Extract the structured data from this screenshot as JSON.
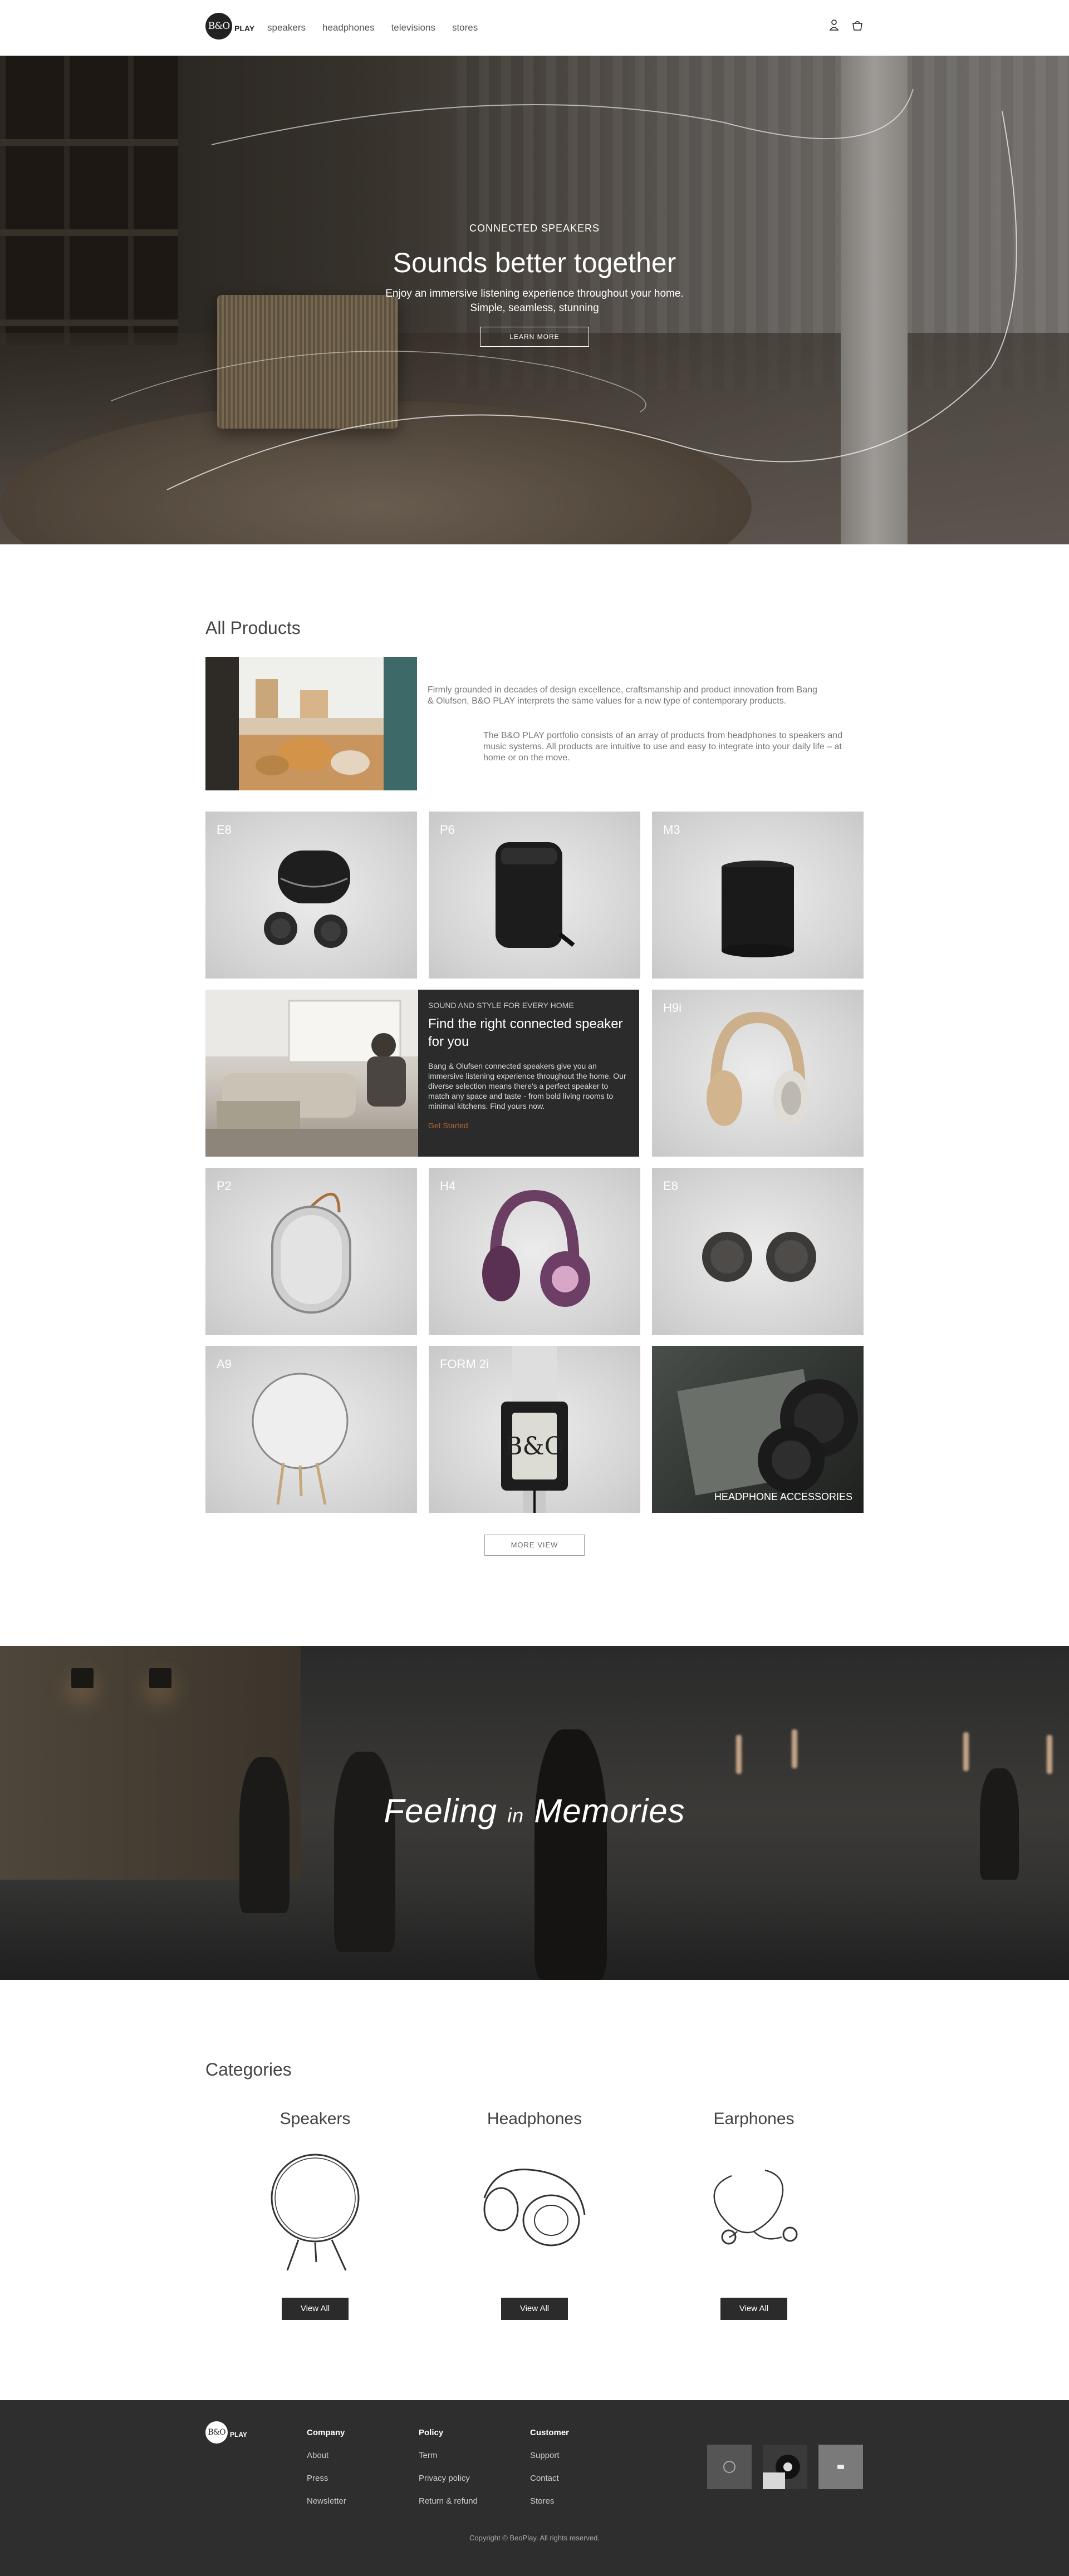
{
  "header": {
    "logo_mark": "B&O",
    "logo_text": "PLAY",
    "nav": [
      "speakers",
      "headphones",
      "televisions",
      "stores"
    ],
    "icons": [
      "user-icon",
      "bag-icon"
    ]
  },
  "hero": {
    "eyebrow": "CONNECTED SPEAKERS",
    "title": "Sounds better together",
    "desc_line1": "Enjoy an immersive listening experience throughout your home.",
    "desc_line2": "Simple, seamless, stunning",
    "button": "LEARN MORE"
  },
  "products": {
    "title": "All Products",
    "intro1": "Firmly grounded in decades of design excellence, craftsmanship and product innovation from Bang & Olufsen, B&O PLAY interprets the same values for a new type of contemporary products.",
    "intro2": "The B&O PLAY portfolio consists of an array of products from headphones to speakers and music systems. All products are intuitive to use and easy to integrate into your daily life – at home or on the move.",
    "items": [
      {
        "name": "E8"
      },
      {
        "name": "P6"
      },
      {
        "name": "M3"
      },
      {
        "name": "H9i"
      },
      {
        "name": "P2"
      },
      {
        "name": "H4"
      },
      {
        "name": "E8"
      },
      {
        "name": "A9"
      },
      {
        "name": "FORM 2i"
      }
    ],
    "feature": {
      "eyebrow": "SOUND AND STYLE FOR EVERY HOME",
      "title": "Find the right connected speaker for you",
      "body": "Bang & Olufsen connected speakers give you an immersive listening experience throughout the home. Our diverse selection means there's a perfect speaker to match any space and taste - from bold living rooms to minimal kitchens. Find yours now.",
      "link": "Get Started"
    },
    "accessory": "HEADPHONE ACCESSORIES",
    "more": "MORE VIEW"
  },
  "banner": {
    "word1": "Feeling",
    "word2": "in",
    "word3": "Memories"
  },
  "categories": {
    "title": "Categories",
    "items": [
      {
        "name": "Speakers",
        "button": "View All"
      },
      {
        "name": "Headphones",
        "button": "View All"
      },
      {
        "name": "Earphones",
        "button": "View All"
      }
    ]
  },
  "footer": {
    "logo_mark": "B&O",
    "logo_text": "PLAY",
    "columns": [
      {
        "heading": "Company",
        "links": [
          "About",
          "Press",
          "Newsletter"
        ]
      },
      {
        "heading": "Policy",
        "links": [
          "Term",
          "Privacy policy",
          "Return & refund"
        ]
      },
      {
        "heading": "Customer",
        "links": [
          "Support",
          "Contact",
          "Stores"
        ]
      }
    ],
    "copyright": "Copyright © BeoPlay. All rights reserved."
  }
}
